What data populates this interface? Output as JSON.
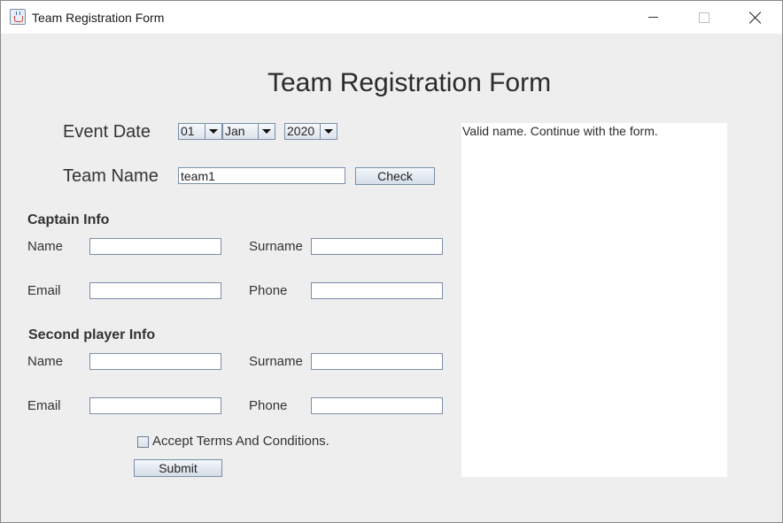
{
  "window": {
    "title": "Team Registration Form"
  },
  "form": {
    "heading": "Team Registration Form",
    "event_date": {
      "label": "Event Date",
      "day": "01",
      "month": "Jan",
      "year": "2020"
    },
    "team_name": {
      "label": "Team Name",
      "value": "team1",
      "check_label": "Check"
    },
    "captain": {
      "title": "Captain Info",
      "name_label": "Name",
      "surname_label": "Surname",
      "email_label": "Email",
      "phone_label": "Phone",
      "name_value": "",
      "surname_value": "",
      "email_value": "",
      "phone_value": ""
    },
    "second_player": {
      "title": "Second player Info",
      "name_label": "Name",
      "surname_label": "Surname",
      "email_label": "Email",
      "phone_label": "Phone",
      "name_value": "",
      "surname_value": "",
      "email_value": "",
      "phone_value": ""
    },
    "terms_label": "Accept Terms And Conditions.",
    "terms_checked": false,
    "submit_label": "Submit"
  },
  "message_area": {
    "text": "Valid name. Continue with the form."
  },
  "icons": {
    "app": "java-icon",
    "minimize": "minimize-icon",
    "maximize": "maximize-icon",
    "close": "close-icon",
    "dropdown": "chevron-down-icon"
  }
}
